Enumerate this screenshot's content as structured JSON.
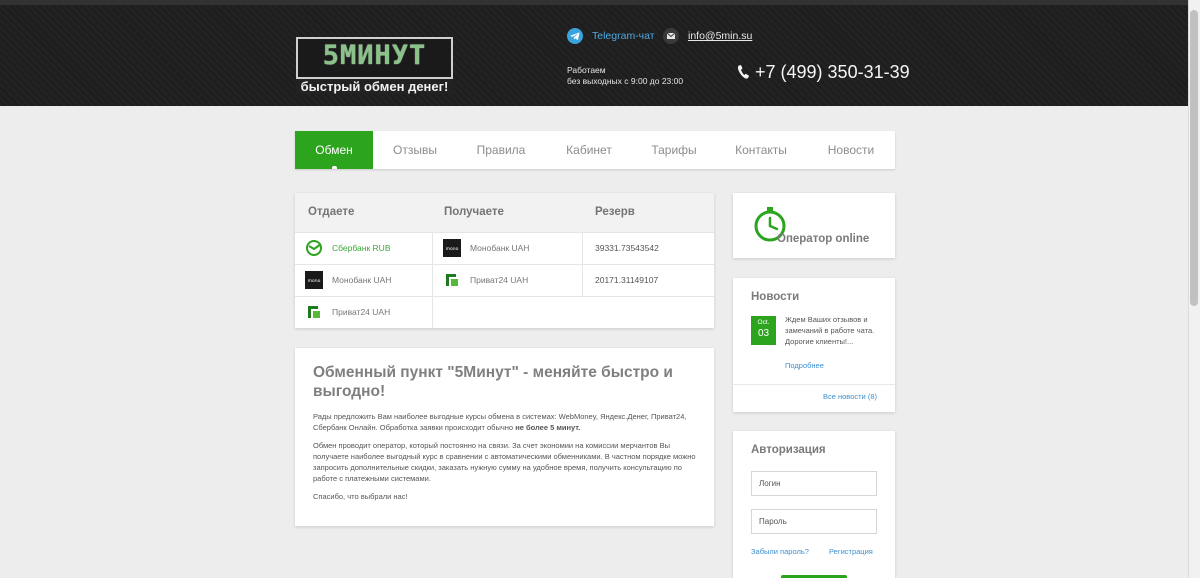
{
  "header": {
    "logo_text": "5МИНУТ",
    "logo_tagline": "быстрый обмен денег!",
    "telegram_label": "Telegram-чат",
    "email": "info@5min.su",
    "hours_title": "Работаем",
    "hours_value": "без выходных с 9:00 до 23:00",
    "phone": "+7 (499) 350-31-39",
    "colors": {
      "background": "#1e1e1e",
      "telegram": "#3aa3dd"
    }
  },
  "nav": {
    "active_color": "#2da41e",
    "items": [
      {
        "label": "Обмен",
        "active": true
      },
      {
        "label": "Отзывы",
        "active": false
      },
      {
        "label": "Правила",
        "active": false
      },
      {
        "label": "Кабинет",
        "active": false
      },
      {
        "label": "Тарифы",
        "active": false
      },
      {
        "label": "Контакты",
        "active": false
      },
      {
        "label": "Новости",
        "active": false
      }
    ]
  },
  "rates": {
    "col_give": "Отдаете",
    "col_get": "Получаете",
    "col_reserve": "Резерв",
    "give": [
      {
        "name": "Сбербанк RUB",
        "icon": "sberbank-icon",
        "selected": true
      },
      {
        "name": "Монобанк UAH",
        "icon": "monobank-icon",
        "selected": false
      },
      {
        "name": "Приват24 UAH",
        "icon": "privat24-icon",
        "selected": false
      }
    ],
    "get": [
      {
        "name": "Монобанк UAH",
        "icon": "monobank-icon",
        "reserve": "39331.73543542"
      },
      {
        "name": "Приват24 UAH",
        "icon": "privat24-icon",
        "reserve": "20171.31149107"
      }
    ]
  },
  "about": {
    "title": "Обменный пункт \"5Минут\" - меняйте быстро и выгодно!",
    "p1_text": "Рады предложить Вам наиболее выгодные курсы обмена в системах: WebMoney, Яндекс.Денег, Приват24, Сбербанк Онлайн. Обработка заявки происходит обычно ",
    "p1_bold": "не более 5 минут.",
    "p2": "Обмен проводит оператор, который постоянно на связи. За счет экономии на комиссии мерчантов Вы получаете наиболее выгодный курс в сравнении с автоматическими обменниками. В частном порядке можно запросить дополнительные скидки, заказать нужную сумму на удобное время, получить консультацию по работе с платежными системами.",
    "p3": "Спасибо, что выбрали нас!"
  },
  "operator": {
    "label": "Оператор online",
    "icon": "clock-icon",
    "color": "#2da41e"
  },
  "news": {
    "title": "Новости",
    "items": [
      {
        "month": "Oct.",
        "day": "03",
        "text": "Ждем Ваших отзывов и замечаний в работе чата. Дорогие клиенты!...",
        "more_label": "Подробнее"
      }
    ],
    "all_label": "Все новости (8)"
  },
  "auth": {
    "title": "Авторизация",
    "login_placeholder": "Логин",
    "password_placeholder": "Пароль",
    "forgot_label": "Забыли пароль?",
    "register_label": "Регистрация"
  }
}
